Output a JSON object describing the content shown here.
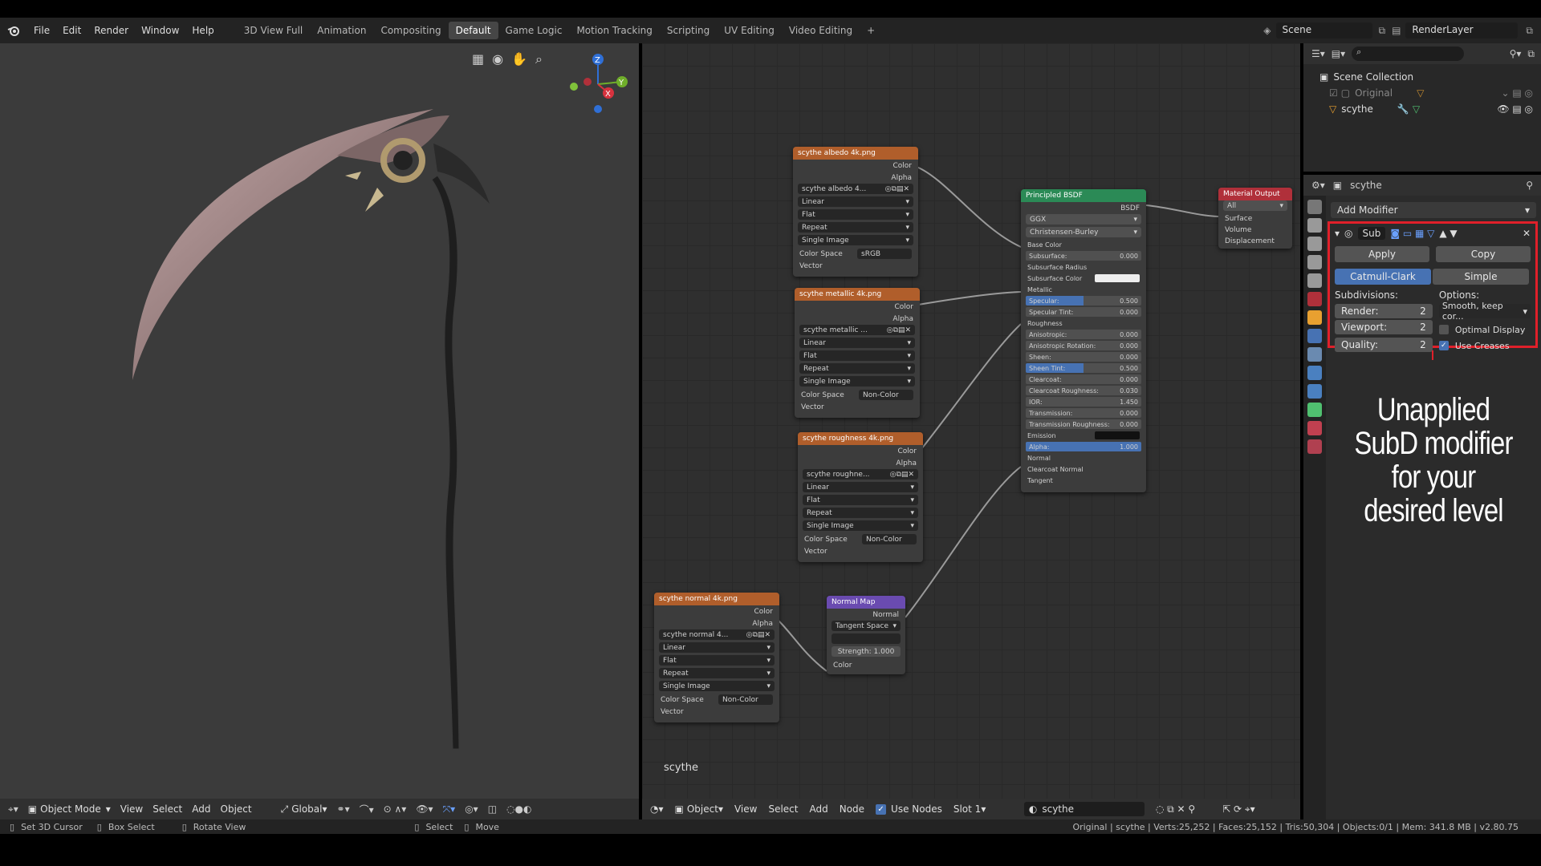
{
  "app": {
    "logo": "blender-icon"
  },
  "menu": [
    "File",
    "Edit",
    "Render",
    "Window",
    "Help"
  ],
  "workspaces": [
    "3D View Full",
    "Animation",
    "Compositing",
    "Default",
    "Game Logic",
    "Motion Tracking",
    "Scripting",
    "UV Editing",
    "Video Editing",
    "+"
  ],
  "scene": {
    "label": "Scene",
    "layer": "RenderLayer"
  },
  "gizmo": {
    "x": "X",
    "y": "Y",
    "z": "Z"
  },
  "viewport_header": {
    "mode": "Object Mode",
    "view": "View",
    "select": "Select",
    "add": "Add",
    "object": "Object",
    "orientation": "Global"
  },
  "node_header": {
    "type": "Object",
    "view": "View",
    "select": "Select",
    "add": "Add",
    "node": "Node",
    "use_nodes": "Use Nodes",
    "slot": "Slot 1",
    "material": "scythe"
  },
  "node_editor_label": "scythe",
  "nodes": {
    "albedo": {
      "title": "scythe albedo 4k.png",
      "out1": "Color",
      "out2": "Alpha",
      "image": "scythe albedo 4...",
      "interp": "Linear",
      "proj": "Flat",
      "ext": "Repeat",
      "src": "Single Image",
      "cs_label": "Color Space",
      "cs": "sRGB",
      "vector": "Vector"
    },
    "metallic": {
      "title": "scythe metallic 4k.png",
      "out1": "Color",
      "out2": "Alpha",
      "image": "scythe metallic ...",
      "interp": "Linear",
      "proj": "Flat",
      "ext": "Repeat",
      "src": "Single Image",
      "cs_label": "Color Space",
      "cs": "Non-Color",
      "vector": "Vector"
    },
    "roughness": {
      "title": "scythe roughness 4k.png",
      "out1": "Color",
      "out2": "Alpha",
      "image": "scythe roughne...",
      "interp": "Linear",
      "proj": "Flat",
      "ext": "Repeat",
      "src": "Single Image",
      "cs_label": "Color Space",
      "cs": "Non-Color",
      "vector": "Vector"
    },
    "normal": {
      "title": "scythe normal 4k.png",
      "out1": "Color",
      "out2": "Alpha",
      "image": "scythe normal 4...",
      "interp": "Linear",
      "proj": "Flat",
      "ext": "Repeat",
      "src": "Single Image",
      "cs_label": "Color Space",
      "cs": "Non-Color",
      "vector": "Vector"
    },
    "normalmap": {
      "title": "Normal Map",
      "out": "Normal",
      "space": "Tangent Space",
      "strength": "Strength:",
      "strength_val": "1.000",
      "color": "Color"
    },
    "bsdf": {
      "title": "Principled BSDF",
      "out": "BSDF",
      "dist": "GGX",
      "sss": "Christensen-Burley",
      "base": "Base Color",
      "fields": [
        [
          "Subsurface:",
          "0.000"
        ],
        [
          "Subsurface Radius",
          ""
        ],
        [
          "Subsurface Color",
          ""
        ],
        [
          "Metallic",
          ""
        ],
        [
          "Specular:",
          "0.500"
        ],
        [
          "Specular Tint:",
          "0.000"
        ],
        [
          "Roughness",
          ""
        ],
        [
          "Anisotropic:",
          "0.000"
        ],
        [
          "Anisotropic Rotation:",
          "0.000"
        ],
        [
          "Sheen:",
          "0.000"
        ],
        [
          "Sheen Tint:",
          "0.500"
        ],
        [
          "Clearcoat:",
          "0.000"
        ],
        [
          "Clearcoat Roughness:",
          "0.030"
        ],
        [
          "IOR:",
          "1.450"
        ],
        [
          "Transmission:",
          "0.000"
        ],
        [
          "Transmission Roughness:",
          "0.000"
        ],
        [
          "Emission",
          ""
        ],
        [
          "Alpha:",
          "1.000"
        ],
        [
          "Normal",
          ""
        ],
        [
          "Clearcoat Normal",
          ""
        ],
        [
          "Tangent",
          ""
        ]
      ]
    },
    "output": {
      "title": "Material Output",
      "target": "All",
      "s": "Surface",
      "v": "Volume",
      "d": "Displacement"
    }
  },
  "outliner": {
    "collection": "Scene Collection",
    "items": [
      "Original",
      "scythe"
    ]
  },
  "props": {
    "object": "scythe",
    "add_modifier": "Add Modifier",
    "mod_name": "Sub",
    "apply": "Apply",
    "copy": "Copy",
    "catmull": "Catmull-Clark",
    "simple": "Simple",
    "subdiv": "Subdivisions:",
    "options": "Options:",
    "render": "Render:",
    "render_v": "2",
    "viewport": "Viewport:",
    "viewport_v": "2",
    "quality": "Quality:",
    "quality_v": "2",
    "smooth": "Smooth, keep cor...",
    "optimal": "Optimal Display",
    "creases": "Use Creases"
  },
  "annotation": "Unapplied SubD modifier for your desired level",
  "status": {
    "a": "Set 3D Cursor",
    "b": "Box Select",
    "c": "Rotate View",
    "d": "Select",
    "e": "Move",
    "info": "Original | scythe | Verts:25,252 | Faces:25,152 | Tris:50,304 | Objects:0/1 | Mem: 341.8 MB | v2.80.75"
  },
  "colors": {
    "accent": "#4772b3",
    "highlight": "#e0202a",
    "texnode": "#b05e2b",
    "bsdf": "#2b8a56",
    "output": "#b0303a",
    "vector": "#6a4bb0"
  }
}
